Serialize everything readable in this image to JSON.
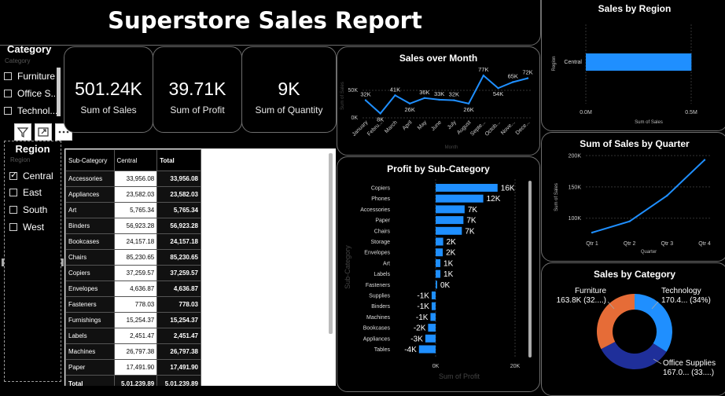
{
  "report": {
    "title": "Superstore Sales Report"
  },
  "colors": {
    "accent": "#1f8fff",
    "navy": "#1f2f9a",
    "orange": "#e66c37",
    "background": "#000000"
  },
  "category_slicer": {
    "title": "Category",
    "subtitle": "Category",
    "items": [
      {
        "label": "Furniture",
        "checked": false
      },
      {
        "label": "Office S...",
        "checked": false
      },
      {
        "label": "Technol...",
        "checked": false
      }
    ]
  },
  "visual_toolbar": {
    "icons": [
      "filter-icon",
      "focus-mode-icon",
      "more-options-icon"
    ]
  },
  "region_slicer": {
    "title": "Region",
    "subtitle": "Region",
    "items": [
      {
        "label": "Central",
        "checked": true
      },
      {
        "label": "East",
        "checked": false
      },
      {
        "label": "South",
        "checked": false
      },
      {
        "label": "West",
        "checked": false
      }
    ]
  },
  "cards": [
    {
      "value": "501.24K",
      "label": "Sum of Sales"
    },
    {
      "value": "39.71K",
      "label": "Sum of Profit"
    },
    {
      "value": "9K",
      "label": "Sum of Quantity"
    }
  ],
  "matrix": {
    "headers": [
      "Sub-Category",
      "Central",
      "Total"
    ],
    "rows": [
      [
        "Accessories",
        "33,956.08",
        "33,956.08"
      ],
      [
        "Appliances",
        "23,582.03",
        "23,582.03"
      ],
      [
        "Art",
        "5,765.34",
        "5,765.34"
      ],
      [
        "Binders",
        "56,923.28",
        "56,923.28"
      ],
      [
        "Bookcases",
        "24,157.18",
        "24,157.18"
      ],
      [
        "Chairs",
        "85,230.65",
        "85,230.65"
      ],
      [
        "Copiers",
        "37,259.57",
        "37,259.57"
      ],
      [
        "Envelopes",
        "4,636.87",
        "4,636.87"
      ],
      [
        "Fasteners",
        "778.03",
        "778.03"
      ],
      [
        "Furnishings",
        "15,254.37",
        "15,254.37"
      ],
      [
        "Labels",
        "2,451.47",
        "2,451.47"
      ],
      [
        "Machines",
        "26,797.38",
        "26,797.38"
      ],
      [
        "Paper",
        "17,491.90",
        "17,491.90"
      ]
    ],
    "total": [
      "Total",
      "5,01,239.89",
      "5,01,239.89"
    ]
  },
  "chart_data": [
    {
      "id": "month",
      "type": "line",
      "title": "Sales over Month",
      "xlabel": "Month",
      "ylabel": "Sum of Sales",
      "categories": [
        "January",
        "Febru...",
        "March",
        "April",
        "May",
        "June",
        "July",
        "August",
        "Septe...",
        "Octob...",
        "Nove...",
        "Dece..."
      ],
      "values": [
        32000,
        8000,
        41000,
        26000,
        36000,
        33000,
        32000,
        26000,
        77000,
        54000,
        65000,
        72000
      ],
      "data_labels": [
        "32K",
        "8K",
        "41K",
        "26K",
        "36K",
        "33K",
        "32K",
        "26K",
        "77K",
        "54K",
        "65K",
        "72K"
      ],
      "y_ticks": [
        "50K",
        "0K"
      ],
      "ylim": [
        0,
        80000
      ]
    },
    {
      "id": "region",
      "type": "bar",
      "orientation": "horizontal",
      "title": "Sales by Region",
      "xlabel": "Sum of Sales",
      "ylabel": "Region",
      "categories": [
        "Central"
      ],
      "values": [
        501240
      ],
      "x_ticks": [
        "0.0M",
        "0.5M"
      ],
      "xlim": [
        0,
        500000
      ]
    },
    {
      "id": "subcat",
      "type": "bar",
      "orientation": "horizontal",
      "title": "Profit by Sub-Category",
      "xlabel": "Sum of Profit",
      "ylabel": "Sub-Category",
      "categories": [
        "Copiers",
        "Phones",
        "Accessories",
        "Paper",
        "Chairs",
        "Storage",
        "Envelopes",
        "Art",
        "Labels",
        "Fasteners",
        "Supplies",
        "Binders",
        "Machines",
        "Bookcases",
        "Appliances",
        "Tables"
      ],
      "values": [
        15600,
        12000,
        7300,
        7000,
        6600,
        1900,
        1800,
        1200,
        1200,
        200,
        -1000,
        -1000,
        -1300,
        -1900,
        -2600,
        -4200
      ],
      "data_labels": [
        "16K",
        "12K",
        "7K",
        "7K",
        "7K",
        "2K",
        "2K",
        "1K",
        "1K",
        "0K",
        "-1K",
        "-1K",
        "-1K",
        "-2K",
        "-3K",
        "-4K"
      ],
      "x_ticks": [
        "0K",
        "20K"
      ],
      "xlim": [
        -5000,
        20000
      ]
    },
    {
      "id": "quarter",
      "type": "line",
      "title": "Sum of Sales by Quarter",
      "xlabel": "Quarter",
      "ylabel": "Sum of Sales",
      "categories": [
        "Qtr 1",
        "Qtr 2",
        "Qtr 3",
        "Qtr 4"
      ],
      "values": [
        77000,
        95000,
        136000,
        193000
      ],
      "y_ticks": [
        "200K",
        "150K",
        "100K"
      ],
      "ylim": [
        72000,
        200000
      ]
    },
    {
      "id": "category",
      "type": "pie",
      "donut": true,
      "title": "Sales by Category",
      "categories": [
        "Technology",
        "Office Supplies",
        "Furniture"
      ],
      "values": [
        170400,
        167000,
        163800
      ],
      "colors": [
        "#1f8fff",
        "#1f2f9a",
        "#e66c37"
      ],
      "data_labels": [
        {
          "name": "Technology",
          "value": "170.4... (34%)"
        },
        {
          "name": "Office Supplies",
          "value": "167.0... (33....)"
        },
        {
          "name": "Furniture",
          "value": "163.8K (32....)"
        }
      ]
    }
  ]
}
